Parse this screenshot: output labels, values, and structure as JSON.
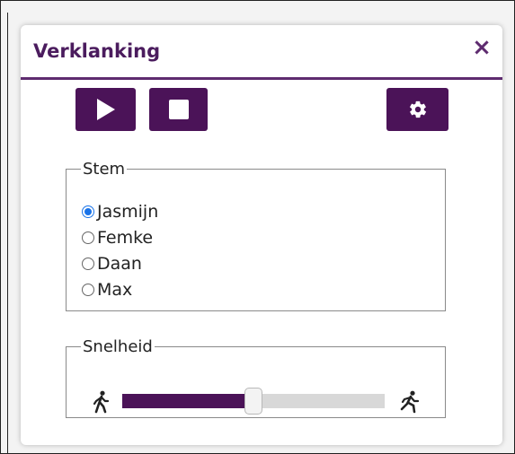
{
  "dialog": {
    "title": "Verklanking",
    "close_label": "×"
  },
  "controls": {
    "play_icon": "play-icon",
    "stop_icon": "stop-icon",
    "settings_icon": "gear-icon"
  },
  "voice": {
    "legend": "Stem",
    "options": [
      "Jasmijn",
      "Femke",
      "Daan",
      "Max"
    ],
    "selected": "Jasmijn"
  },
  "speed": {
    "legend": "Snelheid",
    "slow_icon": "walking-person-icon",
    "fast_icon": "running-person-icon",
    "value_fraction": 0.5
  },
  "colors": {
    "accent": "#4b1358",
    "title": "#4b1c5e",
    "radio_checked": "#1a73e8",
    "track": "#d8d8d8"
  }
}
